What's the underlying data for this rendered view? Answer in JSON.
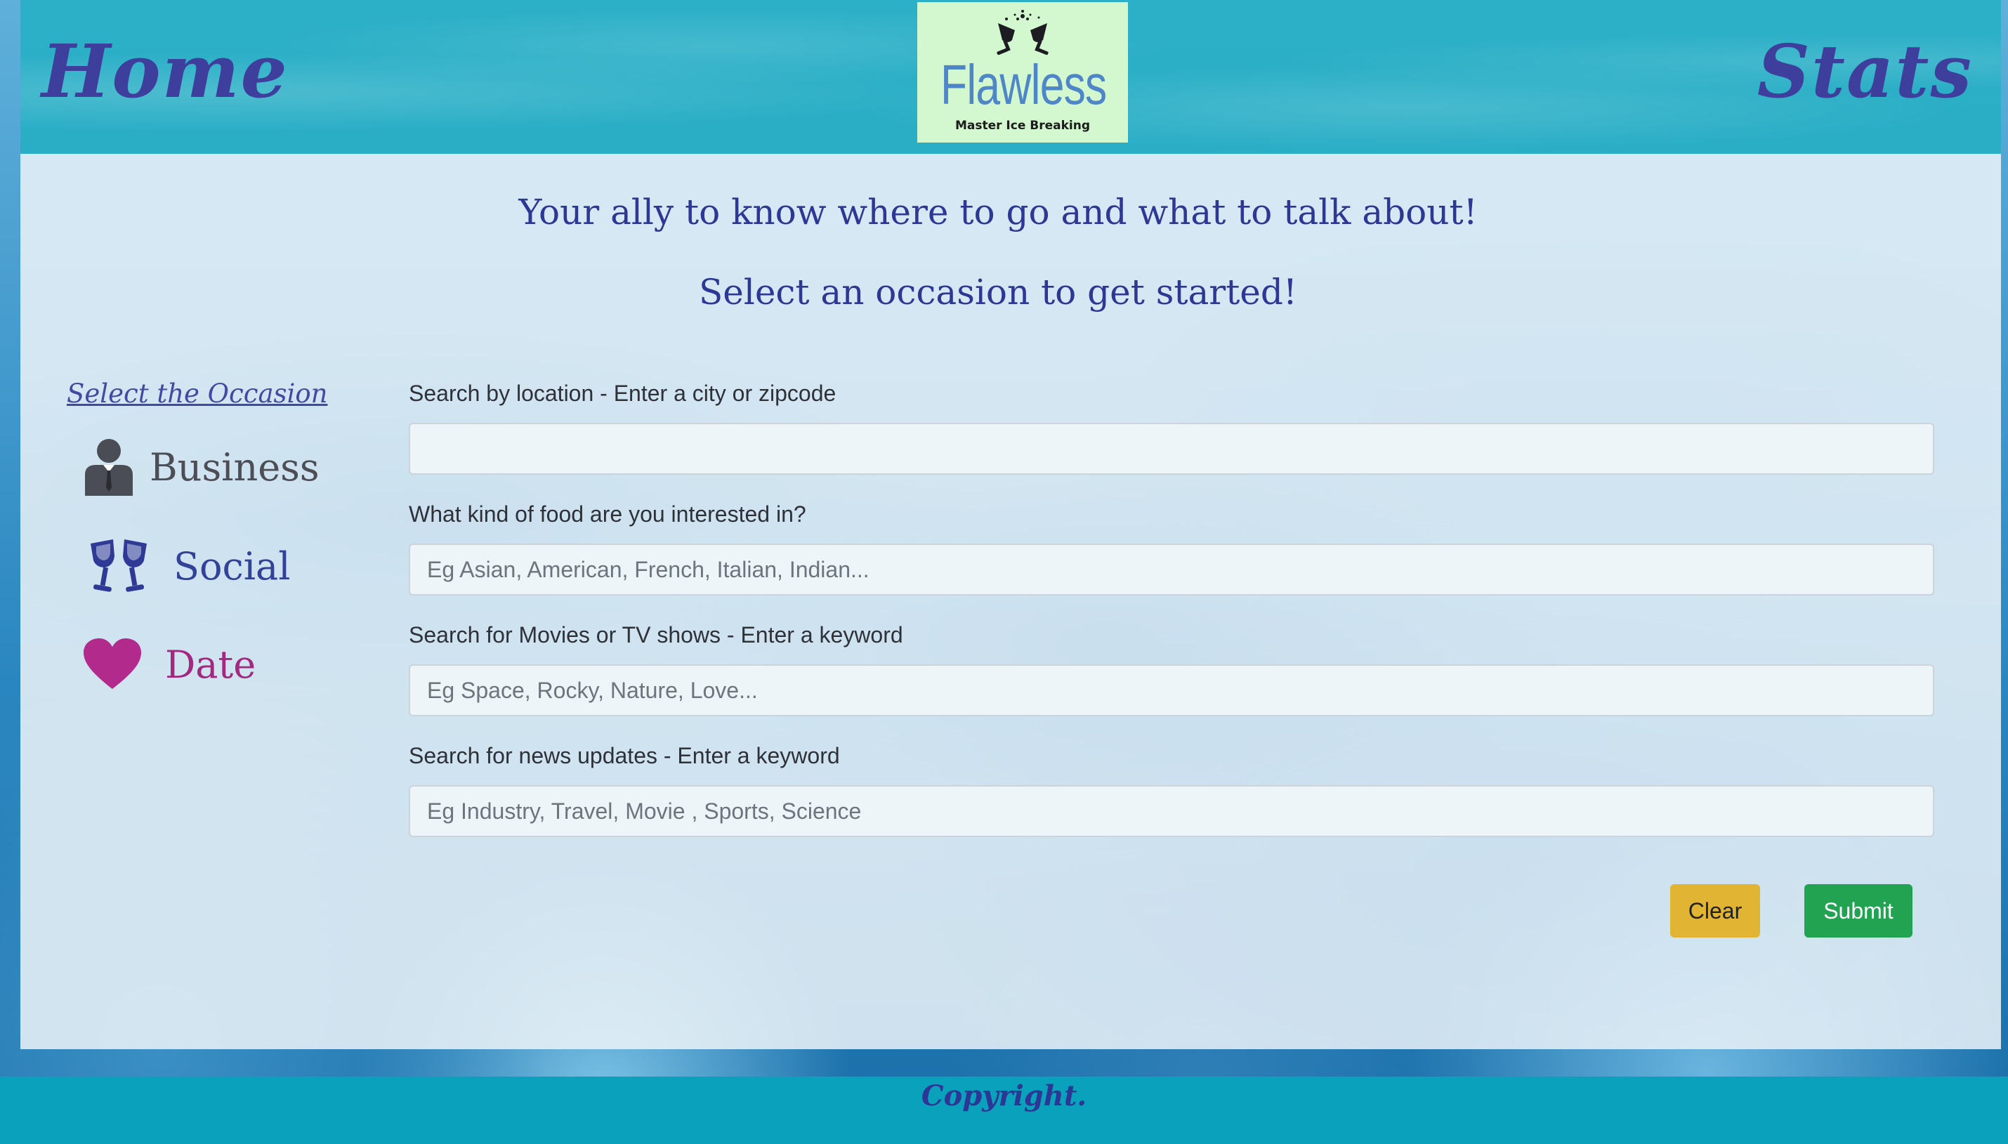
{
  "nav": {
    "home_label": "Home",
    "stats_label": "Stats"
  },
  "logo": {
    "title": "Flawless",
    "tagline": "Master Ice Breaking"
  },
  "intro": {
    "tagline": "Your ally to know where to go and what to talk about!",
    "prompt": "Select an occasion to get started!"
  },
  "occasions": {
    "title": "Select the Occasion",
    "items": [
      {
        "label": "Business",
        "icon": "business-person-icon",
        "color": "#4d4d56"
      },
      {
        "label": "Social",
        "icon": "wine-glasses-icon",
        "color": "#334299"
      },
      {
        "label": "Date",
        "icon": "heart-icon",
        "color": "#a3287f"
      }
    ]
  },
  "form": {
    "location_label": "Search by location - Enter a city or zipcode",
    "location_value": "",
    "location_placeholder": "",
    "food_label": "What kind of food are you interested in?",
    "food_placeholder": "Eg Asian, American, French, Italian, Indian...",
    "movies_label": "Search for Movies or TV shows - Enter a keyword",
    "movies_placeholder": "Eg Space, Rocky, Nature, Love...",
    "news_label": "Search for news updates - Enter a keyword",
    "news_placeholder": "Eg Industry, Travel, Movie , Sports, Science",
    "clear_label": "Clear",
    "submit_label": "Submit"
  },
  "footer": {
    "text": "Copyright."
  },
  "colors": {
    "header_bg": "#2cb0c7",
    "footer_bg": "#0aa1bd",
    "accent_text": "#2d3794",
    "clear_button": "#e1b434",
    "submit_button": "#21a352"
  }
}
